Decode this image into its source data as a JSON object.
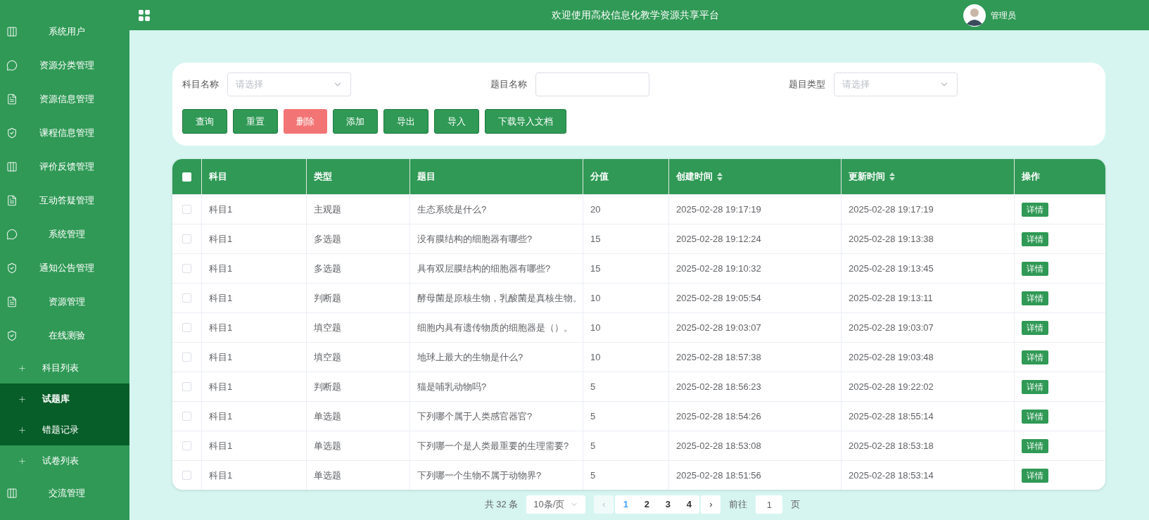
{
  "sidebar": {
    "items": [
      {
        "label": "系统用户"
      },
      {
        "label": "资源分类管理"
      },
      {
        "label": "资源信息管理"
      },
      {
        "label": "课程信息管理"
      },
      {
        "label": "评价反馈管理"
      },
      {
        "label": "互动答疑管理"
      },
      {
        "label": "系统管理"
      },
      {
        "label": "通知公告管理"
      },
      {
        "label": "资源管理"
      },
      {
        "label": "在线测验",
        "children": [
          {
            "label": "科目列表",
            "selected": false,
            "hovered": false
          },
          {
            "label": "试题库",
            "selected": true,
            "hovered": false
          },
          {
            "label": "错题记录",
            "selected": false,
            "hovered": true
          },
          {
            "label": "试卷列表",
            "selected": false,
            "hovered": false
          }
        ]
      },
      {
        "label": "交流管理"
      }
    ]
  },
  "header": {
    "title": "欢迎使用高校信息化教学资源共享平台",
    "user": "管理员"
  },
  "filters": [
    {
      "label": "科目名称",
      "kind": "select",
      "placeholder": "请选择"
    },
    {
      "label": "题目名称",
      "kind": "input"
    },
    {
      "label": "题目类型",
      "kind": "select",
      "placeholder": "请选择"
    }
  ],
  "buttons": [
    {
      "label": "查询",
      "kind": "primary"
    },
    {
      "label": "重置",
      "kind": "primary"
    },
    {
      "label": "删除",
      "kind": "danger"
    },
    {
      "label": "添加",
      "kind": "primary"
    },
    {
      "label": "导出",
      "kind": "primary"
    },
    {
      "label": "导入",
      "kind": "primary"
    },
    {
      "label": "下载导入文档",
      "kind": "primary"
    }
  ],
  "table": {
    "all_checked": false,
    "columns": [
      {
        "label": "科目",
        "sortable": false
      },
      {
        "label": "类型",
        "sortable": false
      },
      {
        "label": "题目",
        "sortable": false
      },
      {
        "label": "分值",
        "sortable": false
      },
      {
        "label": "创建时间",
        "sortable": true
      },
      {
        "label": "更新时间",
        "sortable": true
      },
      {
        "label": "操作",
        "sortable": false
      }
    ],
    "rows": [
      {
        "checked": false,
        "cells": [
          "科目1",
          "主观题",
          "生态系统是什么?",
          "20",
          "2025-02-28 19:17:19",
          "2025-02-28 19:17:19"
        ],
        "action": "详情"
      },
      {
        "checked": false,
        "cells": [
          "科目1",
          "多选题",
          "没有膜结构的细胞器有哪些?",
          "15",
          "2025-02-28 19:12:24",
          "2025-02-28 19:13:38"
        ],
        "action": "详情"
      },
      {
        "checked": false,
        "cells": [
          "科目1",
          "多选题",
          "具有双层膜结构的细胞器有哪些?",
          "15",
          "2025-02-28 19:10:32",
          "2025-02-28 19:13:45"
        ],
        "action": "详情"
      },
      {
        "checked": false,
        "cells": [
          "科目1",
          "判断题",
          "酵母菌是原核生物，乳酸菌是真核生物。",
          "10",
          "2025-02-28 19:05:54",
          "2025-02-28 19:13:11"
        ],
        "action": "详情"
      },
      {
        "checked": false,
        "cells": [
          "科目1",
          "填空题",
          "细胞内具有遗传物质的细胞器是（）。",
          "10",
          "2025-02-28 19:03:07",
          "2025-02-28 19:03:07"
        ],
        "action": "详情"
      },
      {
        "checked": false,
        "cells": [
          "科目1",
          "填空题",
          "地球上最大的生物是什么?",
          "10",
          "2025-02-28 18:57:38",
          "2025-02-28 19:03:48"
        ],
        "action": "详情"
      },
      {
        "checked": false,
        "cells": [
          "科目1",
          "判断题",
          "猫是哺乳动物吗?",
          "5",
          "2025-02-28 18:56:23",
          "2025-02-28 19:22:02"
        ],
        "action": "详情"
      },
      {
        "checked": false,
        "cells": [
          "科目1",
          "单选题",
          "下列哪个属于人类感官器官?",
          "5",
          "2025-02-28 18:54:26",
          "2025-02-28 18:55:14"
        ],
        "action": "详情"
      },
      {
        "checked": false,
        "cells": [
          "科目1",
          "单选题",
          "下列哪一个是人类最重要的生理需要?",
          "5",
          "2025-02-28 18:53:08",
          "2025-02-28 18:53:18"
        ],
        "action": "详情"
      },
      {
        "checked": false,
        "cells": [
          "科目1",
          "单选题",
          "下列哪一个生物不属于动物界?",
          "5",
          "2025-02-28 18:51:56",
          "2025-02-28 18:53:14"
        ],
        "action": "详情"
      }
    ]
  },
  "pagination": {
    "total": "共 32 条",
    "page_size": "10条/页",
    "prev": "‹",
    "pages": [
      {
        "label": "1",
        "selected": true
      },
      {
        "label": "2",
        "selected": false
      },
      {
        "label": "3",
        "selected": false
      },
      {
        "label": "4",
        "selected": false
      }
    ],
    "next": "›",
    "goto_label": "前往",
    "goto_value": "1",
    "goto_suffix": "页"
  }
}
